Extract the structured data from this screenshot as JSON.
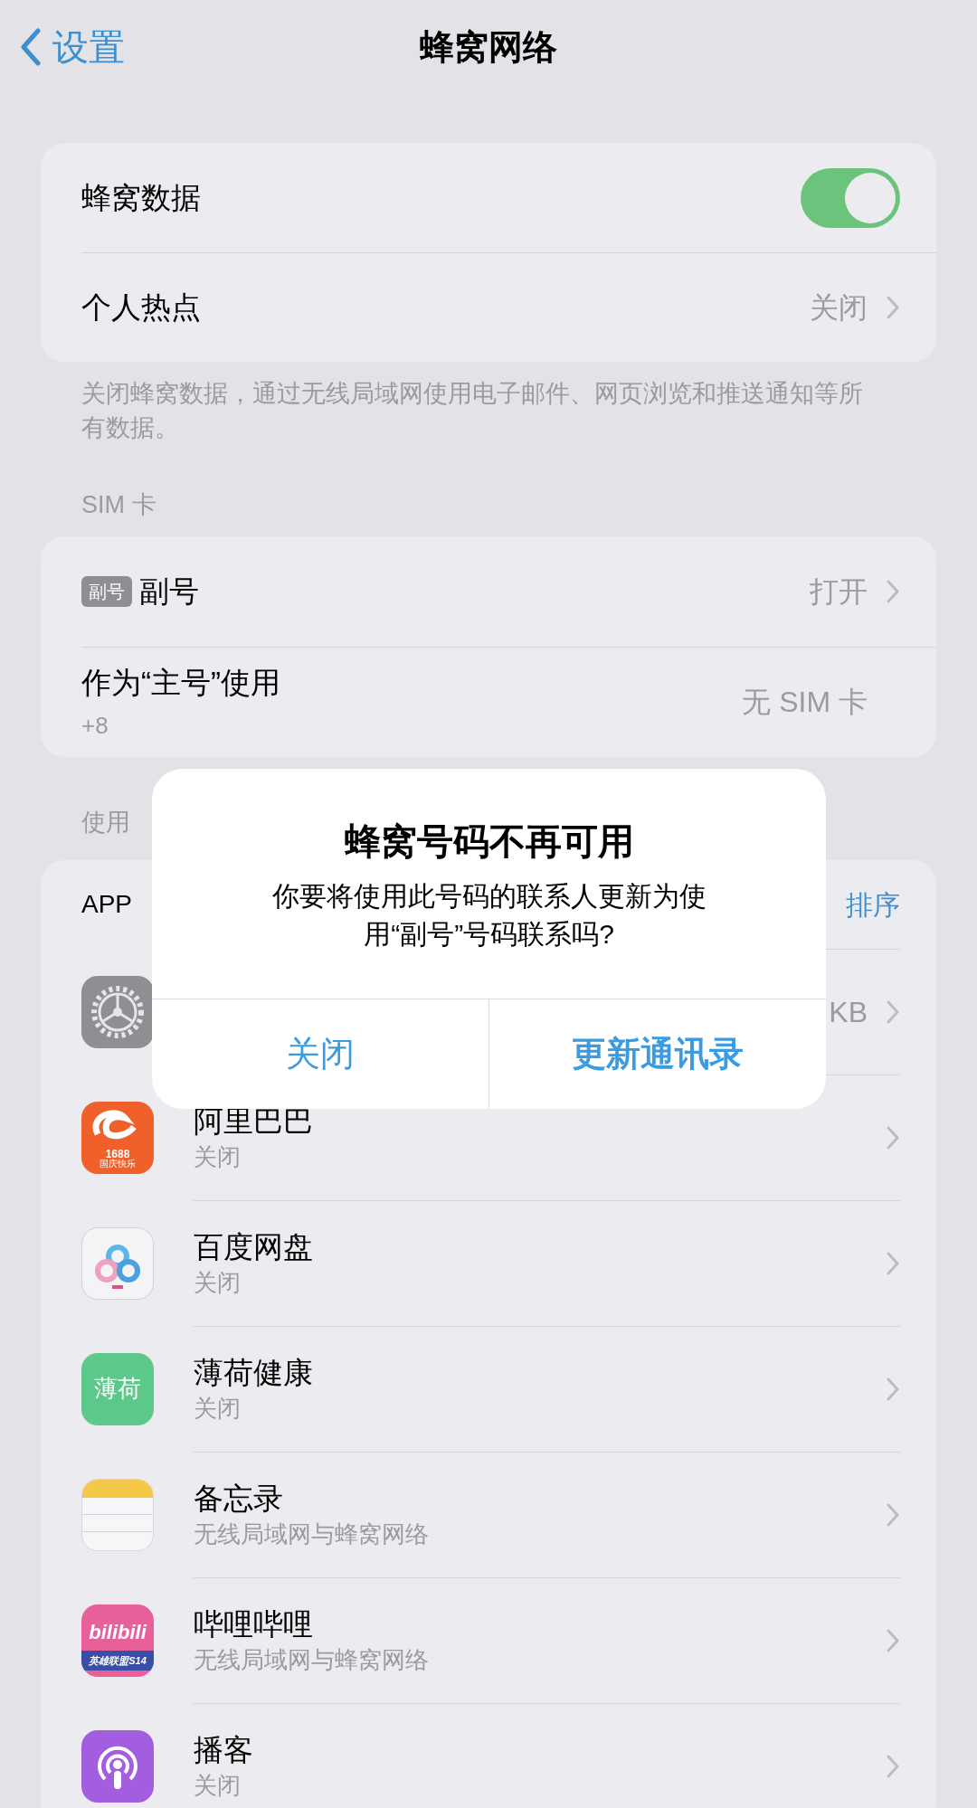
{
  "nav": {
    "back": "设置",
    "title": "蜂窝网络"
  },
  "group1": [
    {
      "kind": "toggle",
      "label": "蜂窝数据",
      "on": true
    },
    {
      "kind": "link",
      "label": "个人热点",
      "value": "关闭"
    }
  ],
  "group1_footer": "关闭蜂窝数据，通过无线局域网使用电子邮件、网页浏览和推送通知等所有数据。",
  "sim_header": "SIM 卡",
  "sim_rows": [
    {
      "badge": "副号",
      "label": "副号",
      "value": "打开",
      "chevron": true
    },
    {
      "label": "作为“主号”使用",
      "sub": "+8",
      "value": "无 SIM 卡",
      "chevron": false
    }
  ],
  "usage_header": "使用",
  "usage_top": {
    "label": "APP",
    "action": "排序"
  },
  "apps": [
    {
      "kind": "settings",
      "value": "KB"
    },
    {
      "kind": "alibaba",
      "name": "阿里巴巴",
      "status": "关闭",
      "icon_texts": [
        "1688",
        "国庆快乐"
      ]
    },
    {
      "kind": "baidu",
      "name": "百度网盘",
      "status": "关闭"
    },
    {
      "kind": "bohe",
      "name": "薄荷健康",
      "status": "关闭",
      "icon_texts": [
        "薄荷"
      ]
    },
    {
      "kind": "notes",
      "name": "备忘录",
      "status": "无线局域网与蜂窝网络"
    },
    {
      "kind": "bilibili",
      "name": "哔哩哔哩",
      "status": "无线局域网与蜂窝网络",
      "icon_texts": [
        "bilibili",
        "英雄联盟S14"
      ]
    },
    {
      "kind": "podcasts",
      "name": "播客",
      "status": "关闭"
    }
  ],
  "alert": {
    "title": "蜂窝号码不再可用",
    "message": "你要将使用此号码的联系人更新为使用“副号”号码联系吗?",
    "buttons": [
      {
        "label": "关闭",
        "bold": false
      },
      {
        "label": "更新通讯录",
        "bold": true
      }
    ]
  }
}
